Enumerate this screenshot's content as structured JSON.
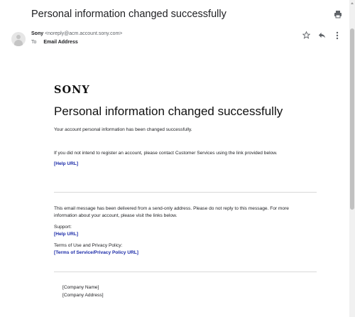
{
  "header": {
    "subject": "Personal information changed successfully",
    "sender_name": "Sony",
    "sender_email": "<noreply@acm.account.sony.com>",
    "to_label": "To",
    "to_address": "Email Address"
  },
  "icons": {
    "print": "print-icon",
    "star": "star-icon",
    "reply": "reply-icon",
    "more": "more-vert-icon",
    "avatar": "avatar-icon"
  },
  "email": {
    "logo": "SONY",
    "title": "Personal information changed successfully",
    "line1": "Your account personal information has been changed successfully.",
    "line2": "If you did not intend to register an account, please contact Customer Services using the link provided below.",
    "help_link": "[Help URL]",
    "notice_1": "This email message has been delivered from a send-only address. Please do not reply to this message. For more",
    "notice_2": "information about your account, please visit the links below.",
    "support_label": "Support:",
    "support_link": "[Help URL]",
    "terms_label": "Terms of Use and Privacy Policy:",
    "terms_link": "[Terms of Service/Privacy Policy URL]",
    "company_name": "[Company Name]",
    "company_address": "[Company Address]"
  },
  "colors": {
    "link": "#1a2aa8",
    "text": "#202124",
    "muted": "#5f6368"
  }
}
